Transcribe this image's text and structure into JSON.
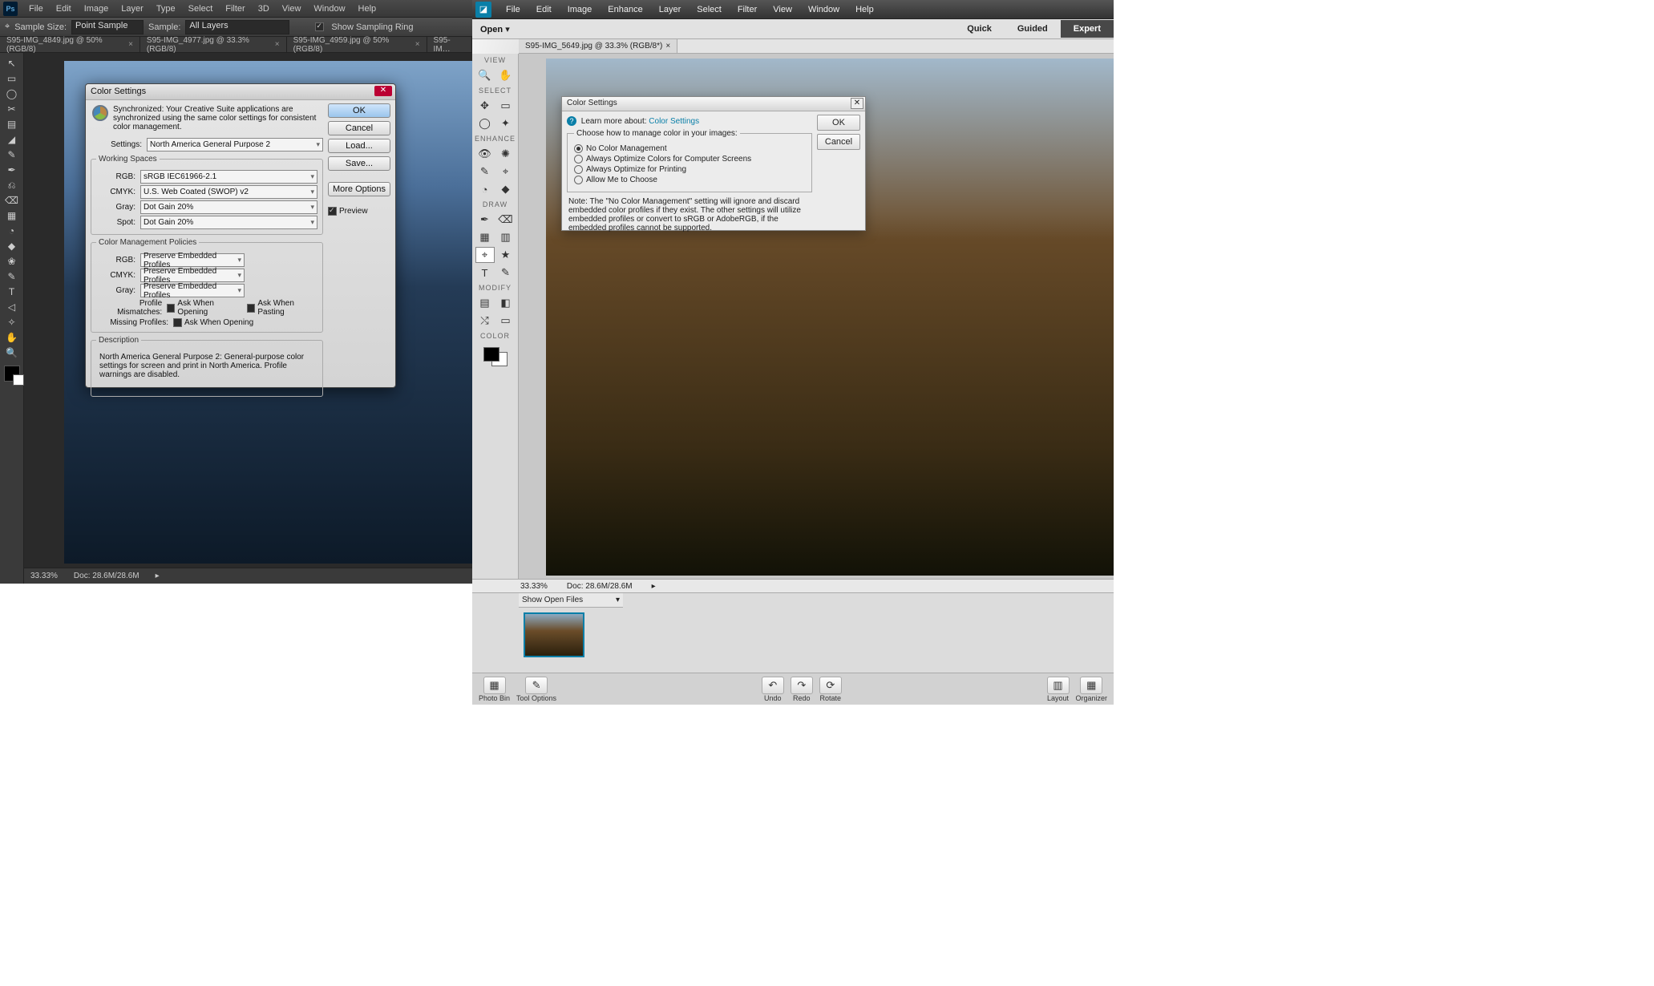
{
  "ps": {
    "menu": [
      "File",
      "Edit",
      "Image",
      "Layer",
      "Type",
      "Select",
      "Filter",
      "3D",
      "View",
      "Window",
      "Help"
    ],
    "optbar": {
      "sample_size_label": "Sample Size:",
      "sample_size_value": "Point Sample",
      "sample_label": "Sample:",
      "sample_value": "All Layers",
      "show_ring_label": "Show Sampling Ring"
    },
    "tabs": [
      "S95-IMG_4849.jpg @ 50% (RGB/8)",
      "S95-IMG_4977.jpg @ 33.3% (RGB/8)",
      "S95-IMG_4959.jpg @ 50% (RGB/8)",
      "S95-IM…"
    ],
    "tools": [
      "↖",
      "▭",
      "◯",
      "✂",
      "▤",
      "◢",
      "✎",
      "✒",
      "⎌",
      "⌫",
      "▦",
      "◔",
      "◆",
      "❀",
      "✎",
      "T",
      "◁",
      "✧",
      "✋",
      "🔍"
    ],
    "status": {
      "zoom": "33.33%",
      "doc": "Doc: 28.6M/28.6M"
    },
    "dialog": {
      "title": "Color Settings",
      "sync": "Synchronized: Your Creative Suite applications are synchronized using the same color settings for consistent color management.",
      "settings_label": "Settings:",
      "settings_value": "North America General Purpose 2",
      "working_spaces": "Working Spaces",
      "rgb_label": "RGB:",
      "rgb_value": "sRGB IEC61966-2.1",
      "cmyk_label": "CMYK:",
      "cmyk_value": "U.S. Web Coated (SWOP) v2",
      "gray_label": "Gray:",
      "gray_value": "Dot Gain 20%",
      "spot_label": "Spot:",
      "spot_value": "Dot Gain 20%",
      "policies": "Color Management Policies",
      "pol_rgb": "Preserve Embedded Profiles",
      "pol_cmyk": "Preserve Embedded Profiles",
      "pol_gray": "Preserve Embedded Profiles",
      "mismatches_label": "Profile Mismatches:",
      "ask_open": "Ask When Opening",
      "ask_paste": "Ask When Pasting",
      "missing_label": "Missing Profiles:",
      "desc_header": "Description",
      "desc": "North America General Purpose 2:  General-purpose color settings for screen and print in North America. Profile warnings are disabled.",
      "btn_ok": "OK",
      "btn_cancel": "Cancel",
      "btn_load": "Load...",
      "btn_save": "Save...",
      "btn_more": "More Options",
      "preview": "Preview"
    }
  },
  "pe": {
    "menu": [
      "File",
      "Edit",
      "Image",
      "Enhance",
      "Layer",
      "Select",
      "Filter",
      "View",
      "Window",
      "Help"
    ],
    "open": "Open",
    "open_arrow": "▾",
    "modes": {
      "quick": "Quick",
      "guided": "Guided",
      "expert": "Expert"
    },
    "tab": "S95-IMG_5649.jpg @ 33.3% (RGB/8*)",
    "tool_headers": {
      "view": "VIEW",
      "select": "SELECT",
      "enhance": "ENHANCE",
      "draw": "DRAW",
      "modify": "MODIFY",
      "color": "COLOR"
    },
    "status": {
      "zoom": "33.33%",
      "doc": "Doc: 28.6M/28.6M"
    },
    "show_open_files": "Show Open Files",
    "foot": [
      "Photo Bin",
      "Tool Options",
      "Undo",
      "Redo",
      "Rotate",
      "Layout",
      "Organizer"
    ],
    "foot_icons": [
      "▦",
      "✎",
      "↶",
      "↷",
      "⟳",
      "▥",
      "▦"
    ],
    "dialog": {
      "title": "Color Settings",
      "learn_label": "Learn more about:",
      "learn_link": "Color Settings",
      "fs_label": "Choose how to manage color in your images:",
      "opts": [
        "No Color Management",
        "Always Optimize Colors for Computer Screens",
        "Always Optimize for Printing",
        "Allow Me to Choose"
      ],
      "note": "Note: The \"No Color Management\" setting will ignore and discard embedded color profiles if they exist. The other settings will utilize embedded profiles or convert to sRGB or AdobeRGB, if the embedded profiles cannot be supported.",
      "btn_ok": "OK",
      "btn_cancel": "Cancel"
    }
  }
}
